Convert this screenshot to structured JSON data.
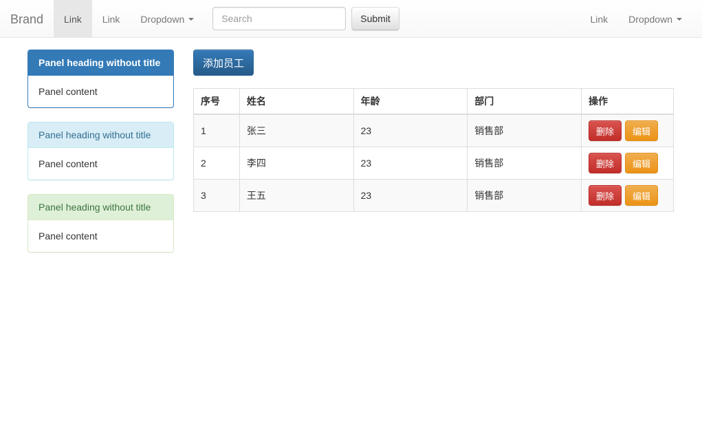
{
  "navbar": {
    "brand": "Brand",
    "left_items": [
      {
        "label": "Link",
        "active": true,
        "type": "link"
      },
      {
        "label": "Link",
        "active": false,
        "type": "link"
      },
      {
        "label": "Dropdown",
        "active": false,
        "type": "dropdown"
      }
    ],
    "form": {
      "search_placeholder": "Search",
      "search_value": "",
      "submit_label": "Submit"
    },
    "right_items": [
      {
        "label": "Link",
        "type": "link"
      },
      {
        "label": "Dropdown",
        "type": "dropdown"
      }
    ],
    "colors": {
      "background": "#f8f8f8",
      "active_background": "#e7e7e7",
      "text": "#777777",
      "border": "#e7e7e7"
    }
  },
  "sidebar": {
    "panels": [
      {
        "variant": "primary",
        "heading": "Panel heading without title",
        "body": "Panel content",
        "heading_bg": "#337ab7",
        "heading_color": "#ffffff"
      },
      {
        "variant": "info",
        "heading": "Panel heading without title",
        "body": "Panel content",
        "heading_bg": "#d9edf7",
        "heading_color": "#31708f"
      },
      {
        "variant": "success",
        "heading": "Panel heading without title",
        "body": "Panel content",
        "heading_bg": "#dff0d8",
        "heading_color": "#3c763d"
      }
    ]
  },
  "main": {
    "add_button": {
      "label": "添加员工",
      "color": "#337ab7"
    },
    "table": {
      "headers": [
        "序号",
        "姓名",
        "年龄",
        "部门",
        "操作"
      ],
      "rows": [
        {
          "seq": "1",
          "name": "张三",
          "age": "23",
          "dept": "销售部",
          "delete_label": "删除",
          "edit_label": "编辑"
        },
        {
          "seq": "2",
          "name": "李四",
          "age": "23",
          "dept": "销售部",
          "delete_label": "删除",
          "edit_label": "编辑"
        },
        {
          "seq": "3",
          "name": "王五",
          "age": "23",
          "dept": "销售部",
          "delete_label": "删除",
          "edit_label": "编辑"
        }
      ],
      "colors": {
        "delete": "#d9534f",
        "edit": "#f0ad4e",
        "stripe": "#f9f9f9",
        "border": "#dddddd"
      }
    }
  }
}
